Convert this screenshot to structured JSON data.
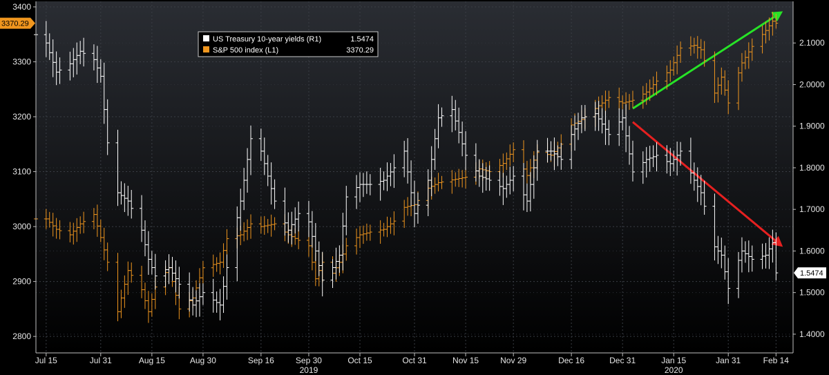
{
  "chart_data": {
    "type": "bar",
    "subtype": "ohlc-bars-dual-axis",
    "title": "",
    "background": "#000000",
    "grid": true,
    "legend": {
      "placement": "top-left",
      "entries": [
        {
          "label": "US Treasury 10-year yields (R1)",
          "value": "1.5474",
          "color": "#ffffff"
        },
        {
          "label": "S&P 500 index (L1)",
          "value": "3370.29",
          "color": "#f0961e"
        }
      ]
    },
    "left_axis": {
      "ylim": [
        2770,
        3410
      ],
      "ticks": [
        "3400",
        "3300",
        "3200",
        "3100",
        "3000",
        "2900",
        "2800"
      ],
      "last_value_tag": "3370.29"
    },
    "right_axis": {
      "ylim": [
        1.355,
        2.2
      ],
      "ticks": [
        "2.1000",
        "2.0000",
        "1.9000",
        "1.8000",
        "1.7000",
        "1.6000",
        "1.5000",
        "1.4000"
      ],
      "last_value_tag": "1.5474"
    },
    "x_axis": {
      "xlim": [
        "2019-07-12",
        "2020-02-19"
      ],
      "date_ticks": [
        {
          "label": "Jul 15",
          "date": "2019-07-15"
        },
        {
          "label": "Jul 31",
          "date": "2019-07-31"
        },
        {
          "label": "Aug 15",
          "date": "2019-08-15"
        },
        {
          "label": "Aug 30",
          "date": "2019-08-30"
        },
        {
          "label": "Sep 16",
          "date": "2019-09-16"
        },
        {
          "label": "Sep 30",
          "date": "2019-09-30"
        },
        {
          "label": "Oct 15",
          "date": "2019-10-15"
        },
        {
          "label": "Oct 31",
          "date": "2019-10-31"
        },
        {
          "label": "Nov 15",
          "date": "2019-11-15"
        },
        {
          "label": "Nov 29",
          "date": "2019-11-29"
        },
        {
          "label": "Dec 16",
          "date": "2019-12-16"
        },
        {
          "label": "Dec 31",
          "date": "2019-12-31"
        },
        {
          "label": "Jan 15",
          "date": "2020-01-15"
        },
        {
          "label": "Jan 31",
          "date": "2020-01-31"
        },
        {
          "label": "Feb 14",
          "date": "2020-02-14"
        }
      ],
      "year_ticks": [
        {
          "label": "2019",
          "date": "2019-09-30"
        },
        {
          "label": "2020",
          "date": "2020-01-15"
        }
      ]
    },
    "series": [
      {
        "name": "S&P 500 index (L1)",
        "axis": "left",
        "color": "#f0961e",
        "values": [
          {
            "x": "2019-07-12",
            "y": 3014
          },
          {
            "x": "2019-07-15",
            "y": 3014
          },
          {
            "x": "2019-07-18",
            "y": 2995
          },
          {
            "x": "2019-07-22",
            "y": 2985
          },
          {
            "x": "2019-07-25",
            "y": 3005
          },
          {
            "x": "2019-07-29",
            "y": 3022
          },
          {
            "x": "2019-07-31",
            "y": 2980
          },
          {
            "x": "2019-08-02",
            "y": 2935
          },
          {
            "x": "2019-08-05",
            "y": 2845
          },
          {
            "x": "2019-08-08",
            "y": 2920
          },
          {
            "x": "2019-08-12",
            "y": 2885
          },
          {
            "x": "2019-08-14",
            "y": 2845
          },
          {
            "x": "2019-08-16",
            "y": 2890
          },
          {
            "x": "2019-08-20",
            "y": 2925
          },
          {
            "x": "2019-08-23",
            "y": 2850
          },
          {
            "x": "2019-08-27",
            "y": 2870
          },
          {
            "x": "2019-08-30",
            "y": 2925
          },
          {
            "x": "2019-09-04",
            "y": 2935
          },
          {
            "x": "2019-09-06",
            "y": 2978
          },
          {
            "x": "2019-09-10",
            "y": 2985
          },
          {
            "x": "2019-09-13",
            "y": 3005
          },
          {
            "x": "2019-09-16",
            "y": 3000
          },
          {
            "x": "2019-09-20",
            "y": 3005
          },
          {
            "x": "2019-09-24",
            "y": 2985
          },
          {
            "x": "2019-09-27",
            "y": 2975
          },
          {
            "x": "2019-09-30",
            "y": 2965
          },
          {
            "x": "2019-10-02",
            "y": 2905
          },
          {
            "x": "2019-10-04",
            "y": 2935
          },
          {
            "x": "2019-10-07",
            "y": 2915
          },
          {
            "x": "2019-10-09",
            "y": 2935
          },
          {
            "x": "2019-10-11",
            "y": 2965
          },
          {
            "x": "2019-10-15",
            "y": 2985
          },
          {
            "x": "2019-10-18",
            "y": 2990
          },
          {
            "x": "2019-10-22",
            "y": 2995
          },
          {
            "x": "2019-10-25",
            "y": 3010
          },
          {
            "x": "2019-10-28",
            "y": 3035
          },
          {
            "x": "2019-10-31",
            "y": 3040
          },
          {
            "x": "2019-11-04",
            "y": 3070
          },
          {
            "x": "2019-11-07",
            "y": 3080
          },
          {
            "x": "2019-11-11",
            "y": 3085
          },
          {
            "x": "2019-11-15",
            "y": 3090
          },
          {
            "x": "2019-11-19",
            "y": 3105
          },
          {
            "x": "2019-11-22",
            "y": 3100
          },
          {
            "x": "2019-11-26",
            "y": 3115
          },
          {
            "x": "2019-11-29",
            "y": 3140
          },
          {
            "x": "2019-12-03",
            "y": 3093
          },
          {
            "x": "2019-12-06",
            "y": 3135
          },
          {
            "x": "2019-12-10",
            "y": 3130
          },
          {
            "x": "2019-12-13",
            "y": 3150
          },
          {
            "x": "2019-12-16",
            "y": 3185
          },
          {
            "x": "2019-12-19",
            "y": 3195
          },
          {
            "x": "2019-12-23",
            "y": 3215
          },
          {
            "x": "2019-12-27",
            "y": 3235
          },
          {
            "x": "2019-12-31",
            "y": 3225
          },
          {
            "x": "2020-01-03",
            "y": 3230
          },
          {
            "x": "2020-01-07",
            "y": 3245
          },
          {
            "x": "2020-01-10",
            "y": 3265
          },
          {
            "x": "2020-01-14",
            "y": 3285
          },
          {
            "x": "2020-01-17",
            "y": 3325
          },
          {
            "x": "2020-01-21",
            "y": 3330
          },
          {
            "x": "2020-01-23",
            "y": 3322
          },
          {
            "x": "2020-01-27",
            "y": 3243
          },
          {
            "x": "2020-01-29",
            "y": 3272
          },
          {
            "x": "2020-01-31",
            "y": 3225
          },
          {
            "x": "2020-02-04",
            "y": 3298
          },
          {
            "x": "2020-02-07",
            "y": 3328
          },
          {
            "x": "2020-02-11",
            "y": 3357
          },
          {
            "x": "2020-02-13",
            "y": 3374
          },
          {
            "x": "2020-02-14",
            "y": 3370.29
          }
        ]
      },
      {
        "name": "US Treasury 10-year yields (R1)",
        "axis": "right",
        "color": "#ffffff",
        "values": [
          {
            "x": "2019-07-12",
            "y": 2.12
          },
          {
            "x": "2019-07-15",
            "y": 2.1
          },
          {
            "x": "2019-07-18",
            "y": 2.03
          },
          {
            "x": "2019-07-22",
            "y": 2.05
          },
          {
            "x": "2019-07-25",
            "y": 2.08
          },
          {
            "x": "2019-07-29",
            "y": 2.06
          },
          {
            "x": "2019-07-31",
            "y": 2.02
          },
          {
            "x": "2019-08-02",
            "y": 1.86
          },
          {
            "x": "2019-08-05",
            "y": 1.74
          },
          {
            "x": "2019-08-08",
            "y": 1.72
          },
          {
            "x": "2019-08-12",
            "y": 1.65
          },
          {
            "x": "2019-08-14",
            "y": 1.58
          },
          {
            "x": "2019-08-16",
            "y": 1.54
          },
          {
            "x": "2019-08-20",
            "y": 1.56
          },
          {
            "x": "2019-08-23",
            "y": 1.52
          },
          {
            "x": "2019-08-27",
            "y": 1.47
          },
          {
            "x": "2019-08-30",
            "y": 1.5
          },
          {
            "x": "2019-09-04",
            "y": 1.47
          },
          {
            "x": "2019-09-06",
            "y": 1.56
          },
          {
            "x": "2019-09-10",
            "y": 1.72
          },
          {
            "x": "2019-09-13",
            "y": 1.87
          },
          {
            "x": "2019-09-16",
            "y": 1.84
          },
          {
            "x": "2019-09-20",
            "y": 1.72
          },
          {
            "x": "2019-09-24",
            "y": 1.65
          },
          {
            "x": "2019-09-27",
            "y": 1.69
          },
          {
            "x": "2019-09-30",
            "y": 1.67
          },
          {
            "x": "2019-10-02",
            "y": 1.6
          },
          {
            "x": "2019-10-04",
            "y": 1.53
          },
          {
            "x": "2019-10-07",
            "y": 1.56
          },
          {
            "x": "2019-10-09",
            "y": 1.59
          },
          {
            "x": "2019-10-11",
            "y": 1.73
          },
          {
            "x": "2019-10-15",
            "y": 1.76
          },
          {
            "x": "2019-10-18",
            "y": 1.76
          },
          {
            "x": "2019-10-22",
            "y": 1.77
          },
          {
            "x": "2019-10-25",
            "y": 1.8
          },
          {
            "x": "2019-10-28",
            "y": 1.84
          },
          {
            "x": "2019-10-31",
            "y": 1.69
          },
          {
            "x": "2019-11-04",
            "y": 1.77
          },
          {
            "x": "2019-11-07",
            "y": 1.92
          },
          {
            "x": "2019-11-11",
            "y": 1.94
          },
          {
            "x": "2019-11-15",
            "y": 1.83
          },
          {
            "x": "2019-11-19",
            "y": 1.78
          },
          {
            "x": "2019-11-22",
            "y": 1.77
          },
          {
            "x": "2019-11-26",
            "y": 1.75
          },
          {
            "x": "2019-11-29",
            "y": 1.78
          },
          {
            "x": "2019-12-03",
            "y": 1.72
          },
          {
            "x": "2019-12-06",
            "y": 1.84
          },
          {
            "x": "2019-12-10",
            "y": 1.84
          },
          {
            "x": "2019-12-13",
            "y": 1.82
          },
          {
            "x": "2019-12-16",
            "y": 1.88
          },
          {
            "x": "2019-12-19",
            "y": 1.92
          },
          {
            "x": "2019-12-23",
            "y": 1.93
          },
          {
            "x": "2019-12-27",
            "y": 1.88
          },
          {
            "x": "2019-12-31",
            "y": 1.92
          },
          {
            "x": "2020-01-03",
            "y": 1.79
          },
          {
            "x": "2020-01-07",
            "y": 1.82
          },
          {
            "x": "2020-01-10",
            "y": 1.83
          },
          {
            "x": "2020-01-14",
            "y": 1.81
          },
          {
            "x": "2020-01-17",
            "y": 1.84
          },
          {
            "x": "2020-01-21",
            "y": 1.77
          },
          {
            "x": "2020-01-23",
            "y": 1.74
          },
          {
            "x": "2020-01-27",
            "y": 1.61
          },
          {
            "x": "2020-01-29",
            "y": 1.59
          },
          {
            "x": "2020-01-31",
            "y": 1.51
          },
          {
            "x": "2020-02-04",
            "y": 1.6
          },
          {
            "x": "2020-02-07",
            "y": 1.58
          },
          {
            "x": "2020-02-11",
            "y": 1.59
          },
          {
            "x": "2020-02-13",
            "y": 1.62
          },
          {
            "x": "2020-02-14",
            "y": 1.5474
          }
        ]
      }
    ],
    "annotations": [
      {
        "type": "arrow",
        "color": "#27e327",
        "axis": "left",
        "from": {
          "x": "2020-01-03",
          "y": 3215
        },
        "to": {
          "x": "2020-02-16",
          "y": 3392
        }
      },
      {
        "type": "arrow",
        "color": "#e62020",
        "axis": "right",
        "from": {
          "x": "2020-01-03",
          "y": 1.91
        },
        "to": {
          "x": "2020-02-16",
          "y": 1.61
        }
      }
    ]
  }
}
